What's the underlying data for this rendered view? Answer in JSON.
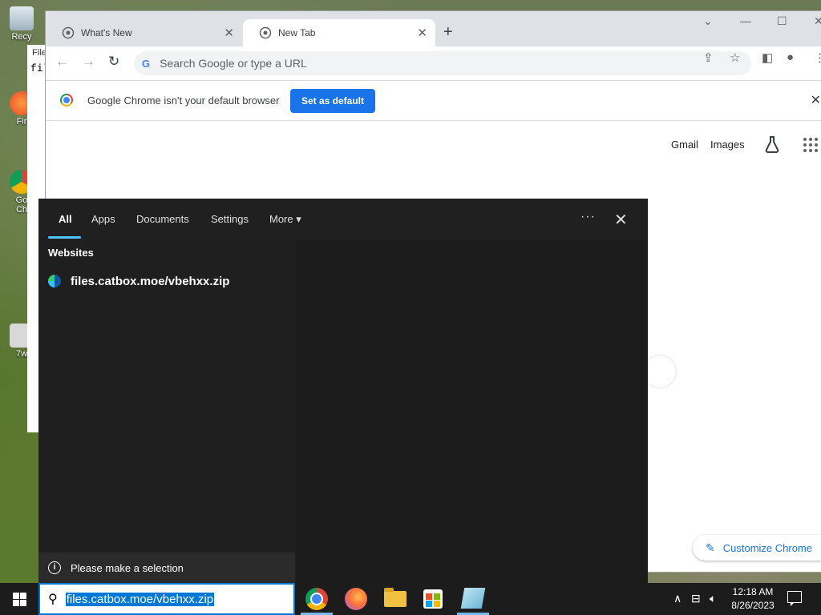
{
  "desktop": {
    "icons": [
      {
        "label": "Recy",
        "name": "recycle-bin-icon"
      },
      {
        "label": "Fir",
        "name": "firefox-desktop-icon"
      },
      {
        "label": "Go\nCh",
        "name": "chrome-desktop-icon"
      },
      {
        "label": "7w",
        "name": "file-desktop-icon"
      }
    ],
    "notepad_peek": {
      "title": "File",
      "text": "fil"
    }
  },
  "chrome": {
    "tabs": [
      {
        "title": "What's New",
        "active": false
      },
      {
        "title": "New Tab",
        "active": true
      }
    ],
    "omnibox_placeholder": "Search Google or type a URL",
    "infobar": {
      "message": "Google Chrome isn't your default browser",
      "button": "Set as default"
    },
    "ntp": {
      "gmail": "Gmail",
      "images": "Images",
      "customize": "Customize Chrome"
    }
  },
  "search_panel": {
    "tabs": [
      "All",
      "Apps",
      "Documents",
      "Settings",
      "More ▾"
    ],
    "active_tab": "All",
    "section": "Websites",
    "result": "files.catbox.moe/vbehxx.zip",
    "status": "Please make a selection"
  },
  "taskbar": {
    "search_value": "files.catbox.moe/vbehxx.zip",
    "apps": [
      "chrome",
      "firefox",
      "file-explorer",
      "microsoft-store",
      "notepad"
    ],
    "clock": {
      "time": "12:18 AM",
      "date": "8/26/2023"
    }
  },
  "colors": {
    "accent": "#0078d7",
    "chrome_blue": "#1a73e8",
    "search_bg": "#202020"
  }
}
